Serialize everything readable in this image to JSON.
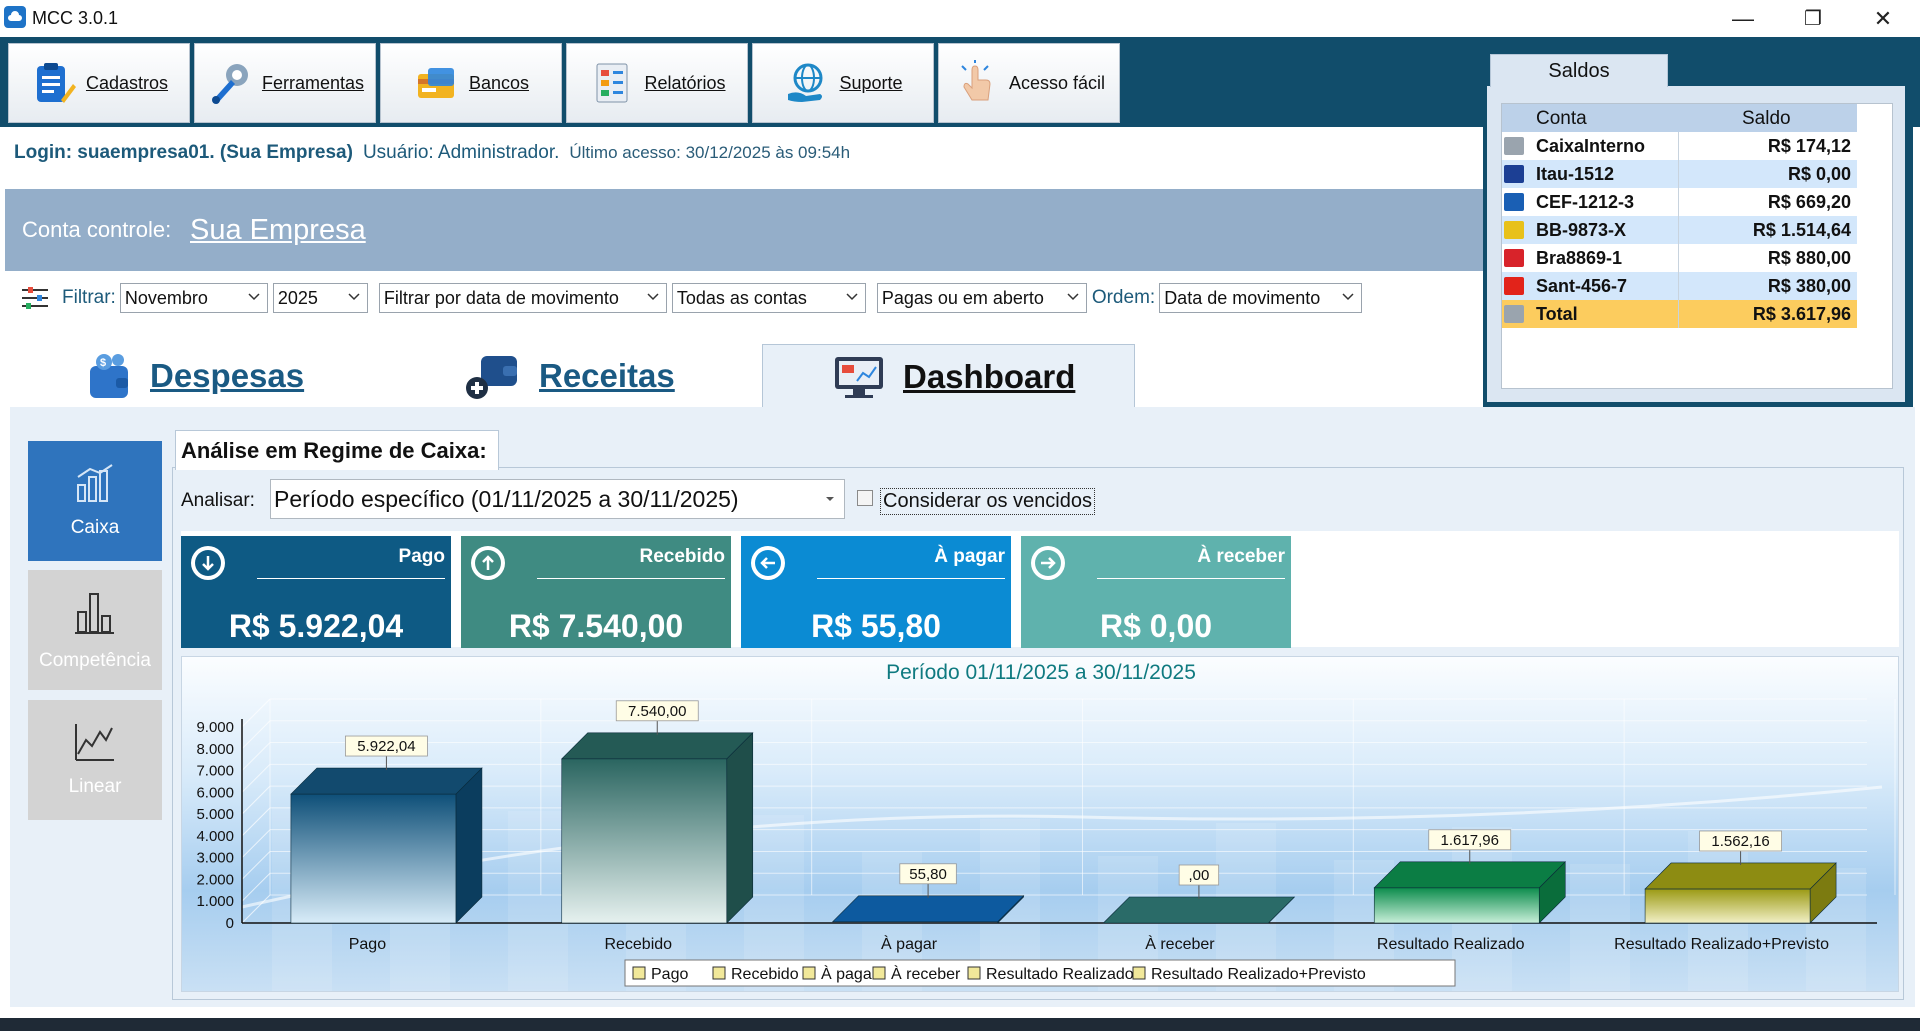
{
  "window": {
    "title": "MCC 3.0.1",
    "minimize": "—",
    "restore": "❐",
    "close": "✕"
  },
  "toolbar": [
    {
      "label": "Cadastros",
      "icon": "clipboard-pencil-icon"
    },
    {
      "label": "Ferramentas",
      "icon": "wrench-gear-icon"
    },
    {
      "label": "Bancos",
      "icon": "bank-card-icon"
    },
    {
      "label": "Relatórios",
      "icon": "report-chart-icon"
    },
    {
      "label": "Suporte",
      "icon": "support-globe-icon"
    },
    {
      "label": "Acesso fácil",
      "icon": "tap-hand-icon"
    }
  ],
  "login": {
    "login_text": "Login: suaempresa01. (Sua Empresa)",
    "user_text": "Usuário: Administrador.",
    "last_access": "Último acesso: 30/12/2025 às 09:54h"
  },
  "conta": {
    "label": "Conta controle:",
    "value": "Sua Empresa"
  },
  "filters": {
    "label": "Filtrar:",
    "month": "Novembro",
    "year": "2025",
    "date_mode": "Filtrar por data de movimento",
    "accounts": "Todas as contas",
    "status": "Pagas ou em aberto",
    "order_label": "Ordem:",
    "order": "Data de movimento"
  },
  "saldos": {
    "tab": "Saldos",
    "col_conta": "Conta",
    "col_saldo": "Saldo",
    "rows": [
      {
        "name": "CaixaInterno",
        "value": "R$ 174,12",
        "icon": "cash-register-icon",
        "color": "#9aa4ae"
      },
      {
        "name": "Itau-1512",
        "value": "R$ 0,00",
        "icon": "itau-bank-icon",
        "color": "#1c3f94"
      },
      {
        "name": "CEF-1212-3",
        "value": "R$ 669,20",
        "icon": "caixa-bank-icon",
        "color": "#1a5fb4"
      },
      {
        "name": "BB-9873-X",
        "value": "R$ 1.514,64",
        "icon": "banco-brasil-icon",
        "color": "#e8c11a"
      },
      {
        "name": "Bra8869-1",
        "value": "R$ 880,00",
        "icon": "bradesco-bank-icon",
        "color": "#d8232a"
      },
      {
        "name": "Sant-456-7",
        "value": "R$ 380,00",
        "icon": "santander-bank-icon",
        "color": "#e2231a"
      }
    ],
    "total": {
      "name": "Total",
      "value": "R$ 3.617,96",
      "icon": "cash-register-icon"
    }
  },
  "tabs": [
    {
      "label": "Despesas",
      "icon": "wallet-money-icon"
    },
    {
      "label": "Receitas",
      "icon": "wallet-add-icon"
    },
    {
      "label": "Dashboard",
      "icon": "dashboard-monitor-icon",
      "active": true
    }
  ],
  "sidebar": [
    {
      "label": "Caixa",
      "icon": "cash-chart-icon",
      "active": true
    },
    {
      "label": "Competência",
      "icon": "bar-chart-icon"
    },
    {
      "label": "Linear",
      "icon": "line-chart-icon"
    }
  ],
  "analysis": {
    "tab_title": "Análise em Regime de Caixa:",
    "analisar_label": "Analisar:",
    "periodo": "Período específico (01/11/2025 a 30/11/2025)",
    "considerar_vencidos": "Considerar os vencidos",
    "considerar_checked": false
  },
  "cards": [
    {
      "label": "Pago",
      "value": "R$ 5.922,04",
      "color": "#0e5a84",
      "icon": "arrow-down-circle-icon"
    },
    {
      "label": "Recebido",
      "value": "R$ 7.540,00",
      "color": "#3f8b82",
      "icon": "arrow-up-circle-icon"
    },
    {
      "label": "À pagar",
      "value": "R$ 55,80",
      "color": "#0b8bd3",
      "icon": "arrow-left-circle-icon"
    },
    {
      "label": "À receber",
      "value": "R$ 0,00",
      "color": "#5fb2ad",
      "icon": "arrow-right-circle-icon"
    }
  ],
  "chart_data": {
    "type": "bar",
    "title": "Período 01/11/2025 a 30/11/2025",
    "xlabel": "",
    "ylabel": "",
    "ylim": [
      0,
      9000
    ],
    "yticks": [
      "0",
      "1.000",
      "2.000",
      "3.000",
      "4.000",
      "5.000",
      "6.000",
      "7.000",
      "8.000",
      "9.000"
    ],
    "categories": [
      "Pago",
      "Recebido",
      "À pagar",
      "À receber",
      "Resultado Realizado",
      "Resultado Realizado+Previsto"
    ],
    "values": [
      5922.04,
      7540.0,
      55.8,
      0.0,
      1617.96,
      1562.16
    ],
    "data_labels": [
      "5.922,04",
      "7.540,00",
      "55,80",
      ",00",
      "1.617,96",
      "1.562,16"
    ],
    "legend": [
      "Pago",
      "Recebido",
      "À pagar",
      "À receber",
      "Resultado Realizado",
      "Resultado Realizado+Previsto"
    ],
    "legend_position": "bottom",
    "grid": true,
    "colors": {
      "Pago": "#0e5a84",
      "Recebido": "#2f6e68",
      "À pagar": "#0b5fa8",
      "À receber": "#2d7471",
      "Resultado Realizado": "#0c8c4c",
      "Resultado Realizado+Previsto": "#9b9a14"
    }
  }
}
